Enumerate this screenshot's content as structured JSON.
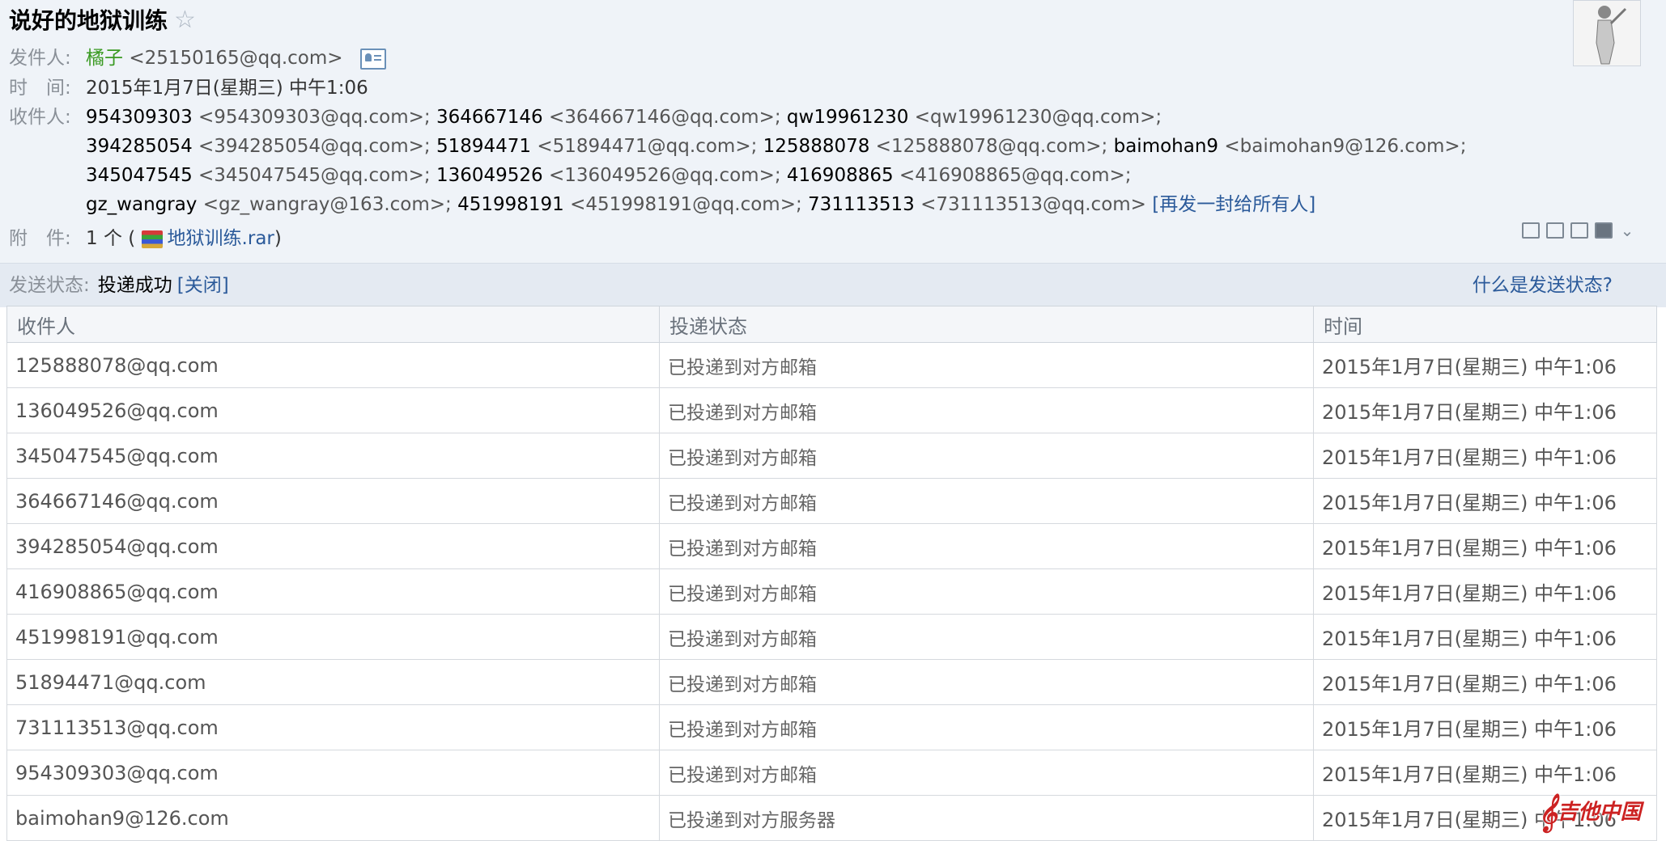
{
  "email": {
    "subject": "说好的地狱训练",
    "star_icon": "☆",
    "labels": {
      "from": "发件人:",
      "time": "时　间:",
      "to": "收件人:",
      "attachment": "附　件:"
    },
    "sender": {
      "name": "橘子",
      "address": "<25150165@qq.com>"
    },
    "time": "2015年1月7日(星期三) 中午1:06",
    "recipients": [
      {
        "name": "954309303",
        "address": "<954309303@qq.com>;"
      },
      {
        "name": "364667146",
        "address": "<364667146@qq.com>;"
      },
      {
        "name": "qw19961230",
        "address": "<qw19961230@qq.com>;"
      },
      {
        "name": "394285054",
        "address": "<394285054@qq.com>;"
      },
      {
        "name": "51894471",
        "address": "<51894471@qq.com>;"
      },
      {
        "name": "125888078",
        "address": "<125888078@qq.com>;"
      },
      {
        "name": "baimohan9",
        "address": "<baimohan9@126.com>;"
      },
      {
        "name": "345047545",
        "address": "<345047545@qq.com>;"
      },
      {
        "name": "136049526",
        "address": "<136049526@qq.com>;"
      },
      {
        "name": "416908865",
        "address": "<416908865@qq.com>;"
      },
      {
        "name": "gz_wangray",
        "address": "<gz_wangray@163.com>;"
      },
      {
        "name": "451998191",
        "address": "<451998191@qq.com>;"
      },
      {
        "name": "731113513",
        "address": "<731113513@qq.com>"
      }
    ],
    "resend_all": "[再发一封给所有人]",
    "attachment": {
      "count": "1 个 (",
      "file": "地狱训练.rar",
      "close_paren": ")"
    }
  },
  "status": {
    "label": "发送状态:",
    "value": "投递成功",
    "close": "[关闭]",
    "help": "什么是发送状态?"
  },
  "table": {
    "headers": [
      "收件人",
      "投递状态",
      "时间"
    ],
    "rows": [
      [
        "125888078@qq.com",
        "已投递到对方邮箱",
        "2015年1月7日(星期三) 中午1:06"
      ],
      [
        "136049526@qq.com",
        "已投递到对方邮箱",
        "2015年1月7日(星期三) 中午1:06"
      ],
      [
        "345047545@qq.com",
        "已投递到对方邮箱",
        "2015年1月7日(星期三) 中午1:06"
      ],
      [
        "364667146@qq.com",
        "已投递到对方邮箱",
        "2015年1月7日(星期三) 中午1:06"
      ],
      [
        "394285054@qq.com",
        "已投递到对方邮箱",
        "2015年1月7日(星期三) 中午1:06"
      ],
      [
        "416908865@qq.com",
        "已投递到对方邮箱",
        "2015年1月7日(星期三) 中午1:06"
      ],
      [
        "451998191@qq.com",
        "已投递到对方邮箱",
        "2015年1月7日(星期三) 中午1:06"
      ],
      [
        "51894471@qq.com",
        "已投递到对方邮箱",
        "2015年1月7日(星期三) 中午1:06"
      ],
      [
        "731113513@qq.com",
        "已投递到对方邮箱",
        "2015年1月7日(星期三) 中午1:06"
      ],
      [
        "954309303@qq.com",
        "已投递到对方邮箱",
        "2015年1月7日(星期三) 中午1:06"
      ],
      [
        "baimohan9@126.com",
        "已投递到对方服务器",
        "2015年1月7日(星期三) 中午1:06"
      ]
    ]
  },
  "watermark": {
    "text": "吉他中国"
  },
  "colors": {
    "header_bg": "#eff3f8",
    "link": "#2b5a9a",
    "sender_green": "#3a9a22",
    "status_bar": "#e4eaf2"
  },
  "icons": [
    "star-icon",
    "contact-card-icon",
    "rar-file-icon",
    "window-icon",
    "note-icon",
    "download-icon",
    "print-icon",
    "chevron-down-icon"
  ]
}
